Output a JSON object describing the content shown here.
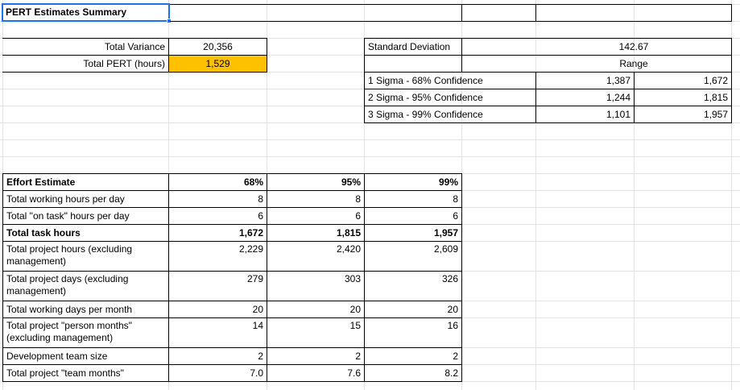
{
  "sheet_title": "PERT Estimates Summary",
  "total_variance_label": "Total Variance",
  "total_variance_value": "20,356",
  "total_pert_label": "Total PERT (hours)",
  "total_pert_value": "1,529",
  "highlight_color": "#ffc000",
  "selection_color": "#1a73e8",
  "std_dev_label": "Standard Deviation",
  "std_dev_value": "142.67",
  "range_label": "Range",
  "confidence": [
    {
      "label": "1 Sigma - 68% Confidence",
      "low": "1,387",
      "high": "1,672"
    },
    {
      "label": "2 Sigma - 95% Confidence",
      "low": "1,244",
      "high": "1,815"
    },
    {
      "label": "3 Sigma - 99% Confidence",
      "low": "1,101",
      "high": "1,957"
    }
  ],
  "effort": {
    "heading": "Effort Estimate",
    "columns": [
      "68%",
      "95%",
      "99%"
    ],
    "rows": [
      {
        "label": "Total working hours per day",
        "values": [
          "8",
          "8",
          "8"
        ]
      },
      {
        "label": "Total \"on task\" hours per day",
        "values": [
          "6",
          "6",
          "6"
        ]
      },
      {
        "label": "Total task hours",
        "values": [
          "1,672",
          "1,815",
          "1,957"
        ]
      },
      {
        "label": "Total project hours (excluding management)",
        "values": [
          "2,229",
          "2,420",
          "2,609"
        ]
      },
      {
        "label": "Total project days (excluding management)",
        "values": [
          "279",
          "303",
          "326"
        ]
      },
      {
        "label": "Total working days per month",
        "values": [
          "20",
          "20",
          "20"
        ]
      },
      {
        "label": "Total project \"person months\" (excluding management)",
        "values": [
          "14",
          "15",
          "16"
        ]
      },
      {
        "label": "Development team size",
        "values": [
          "2",
          "2",
          "2"
        ]
      },
      {
        "label": "Total project \"team months\"",
        "values": [
          "7.0",
          "7.6",
          "8.2"
        ]
      }
    ]
  }
}
